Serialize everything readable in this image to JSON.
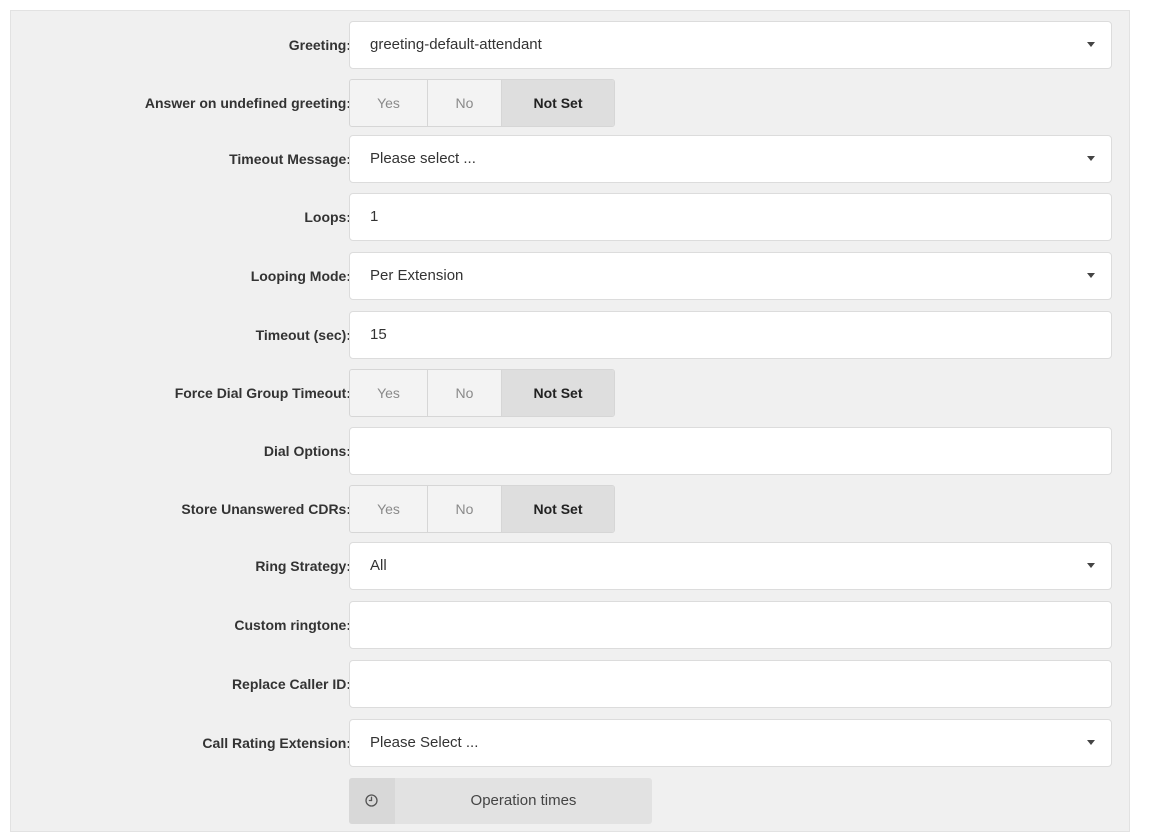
{
  "form": {
    "greeting": {
      "label": "Greeting:",
      "value": "greeting-default-attendant"
    },
    "answer_undefined": {
      "label": "Answer on undefined greeting:",
      "options": [
        "Yes",
        "No",
        "Not Set"
      ],
      "selected": "Not Set"
    },
    "timeout_message": {
      "label": "Timeout Message:",
      "value": "Please select ..."
    },
    "loops": {
      "label": "Loops:",
      "value": "1"
    },
    "looping_mode": {
      "label": "Looping Mode:",
      "value": "Per Extension"
    },
    "timeout_sec": {
      "label": "Timeout (sec):",
      "value": "15"
    },
    "force_dial_group_timeout": {
      "label": "Force Dial Group Timeout:",
      "options": [
        "Yes",
        "No",
        "Not Set"
      ],
      "selected": "Not Set"
    },
    "dial_options": {
      "label": "Dial Options:",
      "value": ""
    },
    "store_unanswered_cdrs": {
      "label": "Store Unanswered CDRs:",
      "options": [
        "Yes",
        "No",
        "Not Set"
      ],
      "selected": "Not Set"
    },
    "ring_strategy": {
      "label": "Ring Strategy:",
      "value": "All"
    },
    "custom_ringtone": {
      "label": "Custom ringtone:",
      "value": ""
    },
    "replace_caller_id": {
      "label": "Replace Caller ID:",
      "value": ""
    },
    "call_rating_extension": {
      "label": "Call Rating Extension:",
      "value": "Please Select ..."
    },
    "operation_times": {
      "label": "Operation times",
      "icon": "clock-icon"
    }
  },
  "colors": {
    "panel_bg": "#f0f0f0",
    "field_bg": "#ffffff",
    "selected_segment_bg": "#dedede"
  }
}
